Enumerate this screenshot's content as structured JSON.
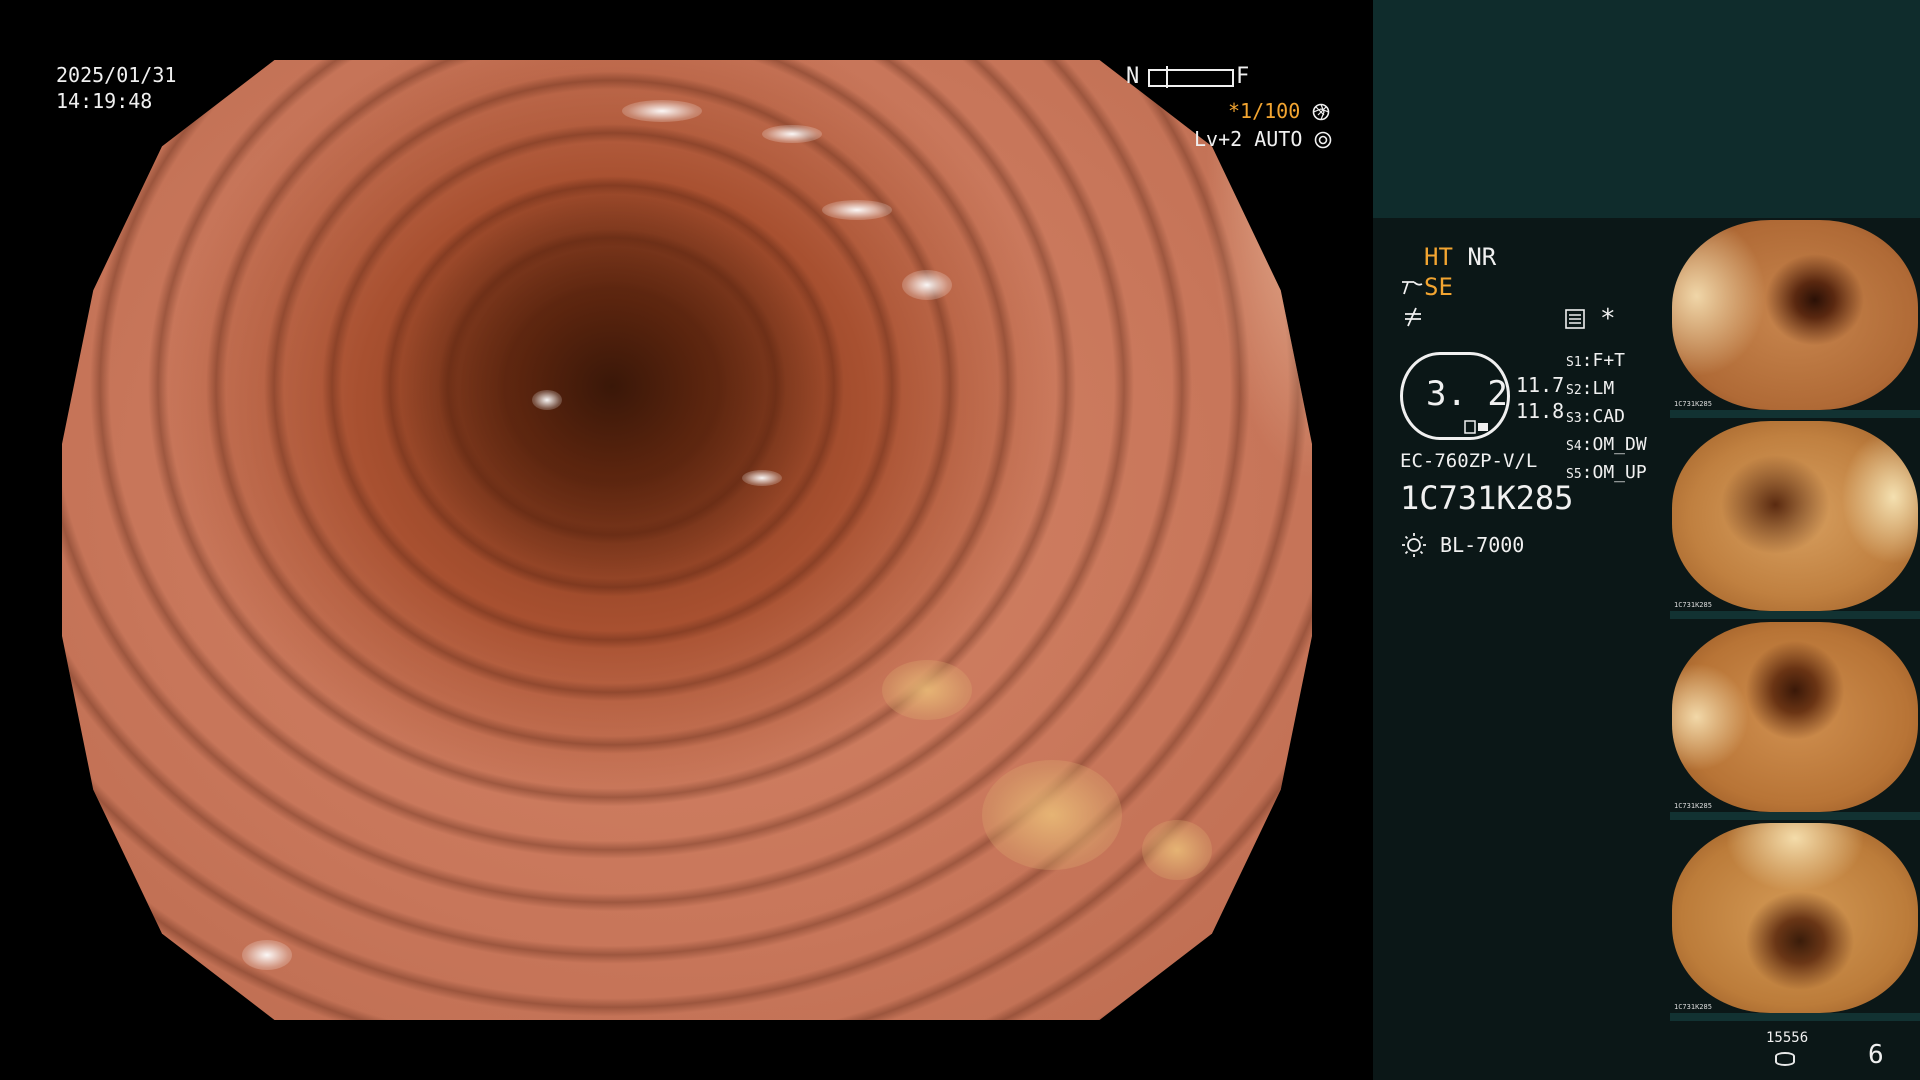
{
  "osd": {
    "date": "2025/01/31",
    "time": "14:19:48",
    "near_label": "N",
    "far_label": "F",
    "shutter": "*1/100",
    "shutter_icon": "aperture-icon",
    "level": "Lv+2",
    "iris": "AUTO",
    "iris_icon": "gear-icon"
  },
  "panel": {
    "ht_label": "HT",
    "nr_label": "NR",
    "se_label": "SE",
    "structure_icon": "structure-enhance-icon",
    "color_icon": "color-mode-icon",
    "menu_icon": "menu-list-icon",
    "asterisk": "*",
    "dial_value": "3. 2",
    "reading_1": "11.7",
    "reading_2": "11.8",
    "scope_model": "EC-760ZP-V/L",
    "serial": "1C731K285",
    "light_source_icon": "lamp-icon",
    "light_source": "BL-7000",
    "switches": [
      {
        "key": "S1",
        "value": "F+T"
      },
      {
        "key": "S2",
        "value": "LM"
      },
      {
        "key": "S3",
        "value": "CAD"
      },
      {
        "key": "S4",
        "value": "OM_DW"
      },
      {
        "key": "S5",
        "value": "OM_UP"
      }
    ],
    "storage_icon": "database-icon",
    "storage_count": "15556",
    "image_count": "6"
  },
  "thumbnails": [
    {
      "caption": "1C731K285"
    },
    {
      "caption": "1C731K285"
    },
    {
      "caption": "1C731K285"
    },
    {
      "caption": "1C731K285"
    }
  ],
  "colors": {
    "accent": "#f3a531",
    "panel_bg": "#0b1717",
    "panel_top": "#0f2c2c"
  }
}
